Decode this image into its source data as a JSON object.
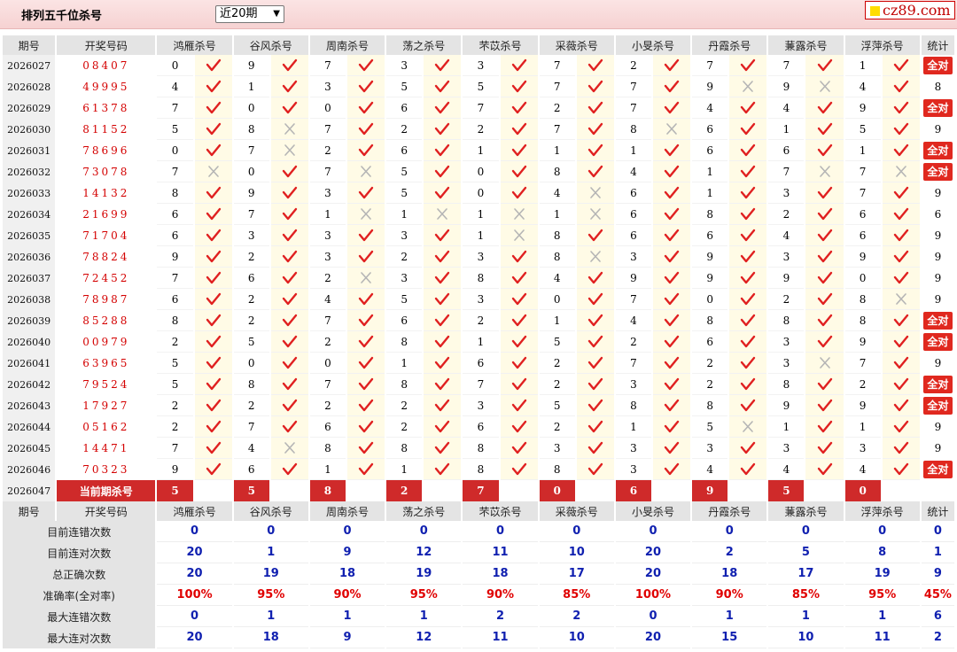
{
  "header": {
    "title": "排列五千位杀号",
    "period_selected": "近20期",
    "logo_text": "cz89.com"
  },
  "columns": {
    "issue": "期号",
    "code": "开奖号码",
    "experts": [
      "鸿雁杀号",
      "谷风杀号",
      "周南杀号",
      "荡之杀号",
      "芣苡杀号",
      "采薇杀号",
      "小旻杀号",
      "丹霞杀号",
      "蒹露杀号",
      "浮萍杀号"
    ],
    "stat": "统计"
  },
  "status_icons": {
    "ok": "red-check-icon",
    "bad": "gray-cross-icon"
  },
  "colors": {
    "accent": "#e0281f",
    "code_red": "#d40000",
    "stat_blue": "#1020b0",
    "mark_bg": "#fffbe6"
  },
  "rows": [
    {
      "issue": "2026027",
      "code": "08407",
      "kills": [
        [
          0,
          1
        ],
        [
          9,
          1
        ],
        [
          7,
          1
        ],
        [
          3,
          1
        ],
        [
          3,
          1
        ],
        [
          7,
          1
        ],
        [
          2,
          1
        ],
        [
          7,
          1
        ],
        [
          7,
          1
        ],
        [
          1,
          1
        ]
      ],
      "stat": "全对"
    },
    {
      "issue": "2026028",
      "code": "49995",
      "kills": [
        [
          4,
          1
        ],
        [
          1,
          1
        ],
        [
          3,
          1
        ],
        [
          5,
          1
        ],
        [
          5,
          1
        ],
        [
          7,
          1
        ],
        [
          7,
          1
        ],
        [
          9,
          0
        ],
        [
          9,
          0
        ],
        [
          4,
          1
        ]
      ],
      "stat": "8"
    },
    {
      "issue": "2026029",
      "code": "61378",
      "kills": [
        [
          7,
          1
        ],
        [
          0,
          1
        ],
        [
          0,
          1
        ],
        [
          6,
          1
        ],
        [
          7,
          1
        ],
        [
          2,
          1
        ],
        [
          7,
          1
        ],
        [
          4,
          1
        ],
        [
          4,
          1
        ],
        [
          9,
          1
        ]
      ],
      "stat": "全对"
    },
    {
      "issue": "2026030",
      "code": "81152",
      "kills": [
        [
          5,
          1
        ],
        [
          8,
          0
        ],
        [
          7,
          1
        ],
        [
          2,
          1
        ],
        [
          2,
          1
        ],
        [
          7,
          1
        ],
        [
          8,
          0
        ],
        [
          6,
          1
        ],
        [
          1,
          1
        ],
        [
          5,
          1
        ]
      ],
      "stat": "9"
    },
    {
      "issue": "2026031",
      "code": "78696",
      "kills": [
        [
          0,
          1
        ],
        [
          7,
          0
        ],
        [
          2,
          1
        ],
        [
          6,
          1
        ],
        [
          1,
          1
        ],
        [
          1,
          1
        ],
        [
          1,
          1
        ],
        [
          6,
          1
        ],
        [
          6,
          1
        ],
        [
          1,
          1
        ]
      ],
      "stat": "全对"
    },
    {
      "issue": "2026032",
      "code": "73078",
      "kills": [
        [
          7,
          0
        ],
        [
          0,
          1
        ],
        [
          7,
          0
        ],
        [
          5,
          1
        ],
        [
          0,
          1
        ],
        [
          8,
          1
        ],
        [
          4,
          1
        ],
        [
          1,
          1
        ],
        [
          7,
          0
        ],
        [
          7,
          0
        ]
      ],
      "stat": "全对"
    },
    {
      "issue": "2026033",
      "code": "14132",
      "kills": [
        [
          8,
          1
        ],
        [
          9,
          1
        ],
        [
          3,
          1
        ],
        [
          5,
          1
        ],
        [
          0,
          1
        ],
        [
          4,
          0
        ],
        [
          6,
          1
        ],
        [
          1,
          1
        ],
        [
          3,
          1
        ],
        [
          7,
          1
        ]
      ],
      "stat": "9"
    },
    {
      "issue": "2026034",
      "code": "21699",
      "kills": [
        [
          6,
          1
        ],
        [
          7,
          1
        ],
        [
          1,
          0
        ],
        [
          1,
          0
        ],
        [
          1,
          0
        ],
        [
          1,
          0
        ],
        [
          6,
          1
        ],
        [
          8,
          1
        ],
        [
          2,
          1
        ],
        [
          6,
          1
        ]
      ],
      "stat": "6"
    },
    {
      "issue": "2026035",
      "code": "71704",
      "kills": [
        [
          6,
          1
        ],
        [
          3,
          1
        ],
        [
          3,
          1
        ],
        [
          3,
          1
        ],
        [
          1,
          0
        ],
        [
          8,
          1
        ],
        [
          6,
          1
        ],
        [
          6,
          1
        ],
        [
          4,
          1
        ],
        [
          6,
          1
        ]
      ],
      "stat": "9"
    },
    {
      "issue": "2026036",
      "code": "78824",
      "kills": [
        [
          9,
          1
        ],
        [
          2,
          1
        ],
        [
          3,
          1
        ],
        [
          2,
          1
        ],
        [
          3,
          1
        ],
        [
          8,
          0
        ],
        [
          3,
          1
        ],
        [
          9,
          1
        ],
        [
          3,
          1
        ],
        [
          9,
          1
        ]
      ],
      "stat": "9"
    },
    {
      "issue": "2026037",
      "code": "72452",
      "kills": [
        [
          7,
          1
        ],
        [
          6,
          1
        ],
        [
          2,
          0
        ],
        [
          3,
          1
        ],
        [
          8,
          1
        ],
        [
          4,
          1
        ],
        [
          9,
          1
        ],
        [
          9,
          1
        ],
        [
          9,
          1
        ],
        [
          0,
          1
        ]
      ],
      "stat": "9"
    },
    {
      "issue": "2026038",
      "code": "78987",
      "kills": [
        [
          6,
          1
        ],
        [
          2,
          1
        ],
        [
          4,
          1
        ],
        [
          5,
          1
        ],
        [
          3,
          1
        ],
        [
          0,
          1
        ],
        [
          7,
          1
        ],
        [
          0,
          1
        ],
        [
          2,
          1
        ],
        [
          8,
          0
        ]
      ],
      "stat": "9"
    },
    {
      "issue": "2026039",
      "code": "85288",
      "kills": [
        [
          8,
          1
        ],
        [
          2,
          1
        ],
        [
          7,
          1
        ],
        [
          6,
          1
        ],
        [
          2,
          1
        ],
        [
          1,
          1
        ],
        [
          4,
          1
        ],
        [
          8,
          1
        ],
        [
          8,
          1
        ],
        [
          8,
          1
        ]
      ],
      "stat": "全对"
    },
    {
      "issue": "2026040",
      "code": "00979",
      "kills": [
        [
          2,
          1
        ],
        [
          5,
          1
        ],
        [
          2,
          1
        ],
        [
          8,
          1
        ],
        [
          1,
          1
        ],
        [
          5,
          1
        ],
        [
          2,
          1
        ],
        [
          6,
          1
        ],
        [
          3,
          1
        ],
        [
          9,
          1
        ]
      ],
      "stat": "全对"
    },
    {
      "issue": "2026041",
      "code": "63965",
      "kills": [
        [
          5,
          1
        ],
        [
          0,
          1
        ],
        [
          0,
          1
        ],
        [
          1,
          1
        ],
        [
          6,
          1
        ],
        [
          2,
          1
        ],
        [
          7,
          1
        ],
        [
          2,
          1
        ],
        [
          3,
          0
        ],
        [
          7,
          1
        ]
      ],
      "stat": "9"
    },
    {
      "issue": "2026042",
      "code": "79524",
      "kills": [
        [
          5,
          1
        ],
        [
          8,
          1
        ],
        [
          7,
          1
        ],
        [
          8,
          1
        ],
        [
          7,
          1
        ],
        [
          2,
          1
        ],
        [
          3,
          1
        ],
        [
          2,
          1
        ],
        [
          8,
          1
        ],
        [
          2,
          1
        ]
      ],
      "stat": "全对"
    },
    {
      "issue": "2026043",
      "code": "17927",
      "kills": [
        [
          2,
          1
        ],
        [
          2,
          1
        ],
        [
          2,
          1
        ],
        [
          2,
          1
        ],
        [
          3,
          1
        ],
        [
          5,
          1
        ],
        [
          8,
          1
        ],
        [
          8,
          1
        ],
        [
          9,
          1
        ],
        [
          9,
          1
        ]
      ],
      "stat": "全对"
    },
    {
      "issue": "2026044",
      "code": "05162",
      "kills": [
        [
          2,
          1
        ],
        [
          7,
          1
        ],
        [
          6,
          1
        ],
        [
          2,
          1
        ],
        [
          6,
          1
        ],
        [
          2,
          1
        ],
        [
          1,
          1
        ],
        [
          5,
          0
        ],
        [
          1,
          1
        ],
        [
          1,
          1
        ]
      ],
      "stat": "9"
    },
    {
      "issue": "2026045",
      "code": "14471",
      "kills": [
        [
          7,
          1
        ],
        [
          4,
          0
        ],
        [
          8,
          1
        ],
        [
          8,
          1
        ],
        [
          8,
          1
        ],
        [
          3,
          1
        ],
        [
          3,
          1
        ],
        [
          3,
          1
        ],
        [
          3,
          1
        ],
        [
          3,
          1
        ]
      ],
      "stat": "9"
    },
    {
      "issue": "2026046",
      "code": "70323",
      "kills": [
        [
          9,
          1
        ],
        [
          6,
          1
        ],
        [
          1,
          1
        ],
        [
          1,
          1
        ],
        [
          8,
          1
        ],
        [
          8,
          1
        ],
        [
          3,
          1
        ],
        [
          4,
          1
        ],
        [
          4,
          1
        ],
        [
          4,
          1
        ]
      ],
      "stat": "全对"
    }
  ],
  "current": {
    "issue": "2026047",
    "label": "当前期杀号",
    "kills": [
      "5",
      "5",
      "8",
      "2",
      "7",
      "0",
      "6",
      "9",
      "5",
      "0"
    ]
  },
  "summary": [
    {
      "label": "目前连错次数",
      "values": [
        "0",
        "0",
        "0",
        "0",
        "0",
        "0",
        "0",
        "0",
        "0",
        "0",
        "0"
      ]
    },
    {
      "label": "目前连对次数",
      "values": [
        "20",
        "1",
        "9",
        "12",
        "11",
        "10",
        "20",
        "2",
        "5",
        "8",
        "1"
      ]
    },
    {
      "label": "总正确次数",
      "values": [
        "20",
        "19",
        "18",
        "19",
        "18",
        "17",
        "20",
        "18",
        "17",
        "19",
        "9"
      ]
    },
    {
      "label": "准确率(全对率)",
      "values": [
        "100%",
        "95%",
        "90%",
        "95%",
        "90%",
        "85%",
        "100%",
        "90%",
        "85%",
        "95%",
        "45%"
      ]
    },
    {
      "label": "最大连错次数",
      "values": [
        "0",
        "1",
        "1",
        "1",
        "2",
        "2",
        "0",
        "1",
        "1",
        "1",
        "6"
      ]
    },
    {
      "label": "最大连对次数",
      "values": [
        "20",
        "18",
        "9",
        "12",
        "11",
        "10",
        "20",
        "15",
        "10",
        "11",
        "2"
      ]
    }
  ]
}
